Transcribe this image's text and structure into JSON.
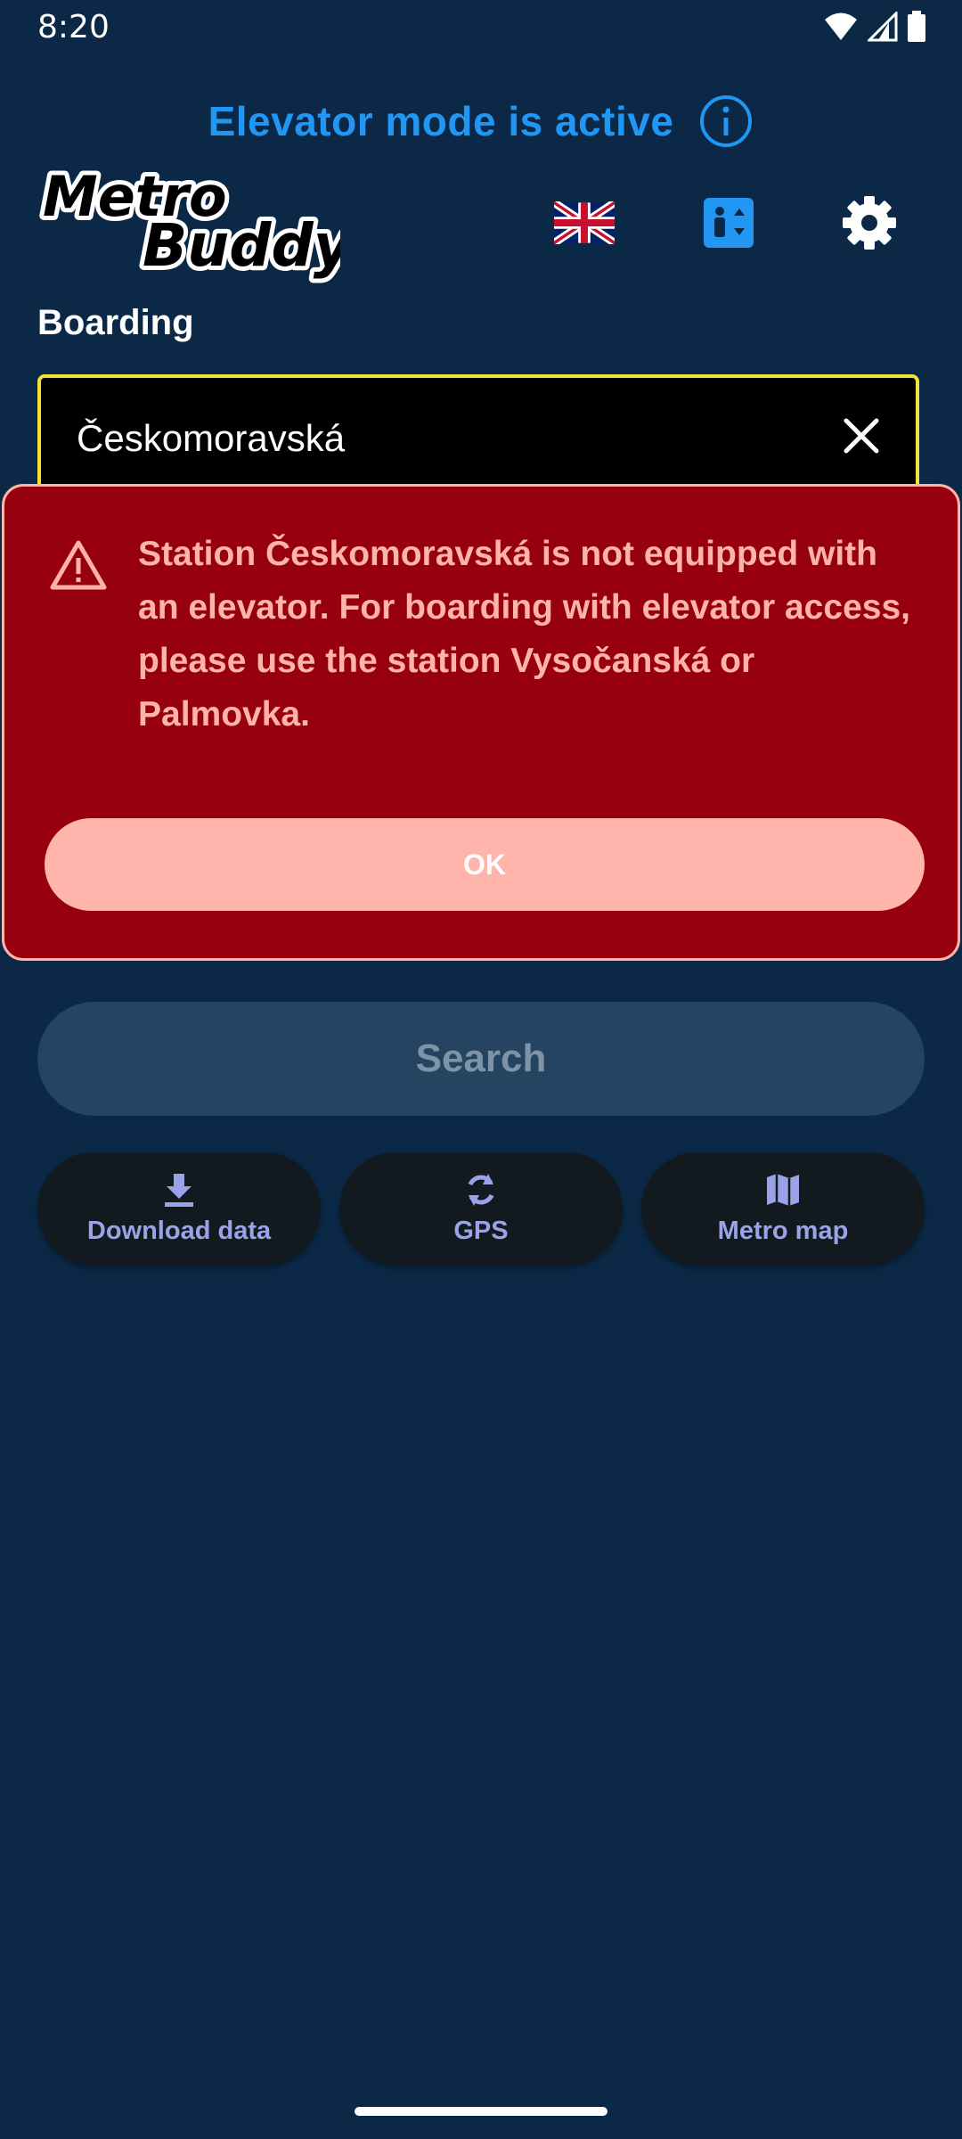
{
  "status_bar": {
    "time": "8:20"
  },
  "elevator_banner": {
    "text": "Elevator mode is active"
  },
  "header": {
    "logo_text_top": "Metro",
    "logo_text_bottom": "Buddy",
    "icons": [
      "uk-flag-icon",
      "elevator-icon",
      "gear-icon"
    ]
  },
  "boarding": {
    "label": "Boarding",
    "value": "Českomoravská"
  },
  "dialog": {
    "message": "Station Českomoravská is not equipped with an elevator. For boarding with elevator access, please use the station Vysočanská or Palmovka.",
    "ok_label": "OK"
  },
  "search": {
    "label": "Search"
  },
  "actions": [
    {
      "label": "Download data",
      "icon": "download-icon"
    },
    {
      "label": "GPS",
      "icon": "refresh-icon"
    },
    {
      "label": "Metro map",
      "icon": "map-icon"
    }
  ],
  "colors": {
    "background": "#0b2946",
    "accent_blue": "#2196f3",
    "dialog_bg": "#96000f",
    "dialog_text": "#ffb4ab",
    "field_border": "#f2e13a",
    "action_label": "#9aa3e8"
  }
}
